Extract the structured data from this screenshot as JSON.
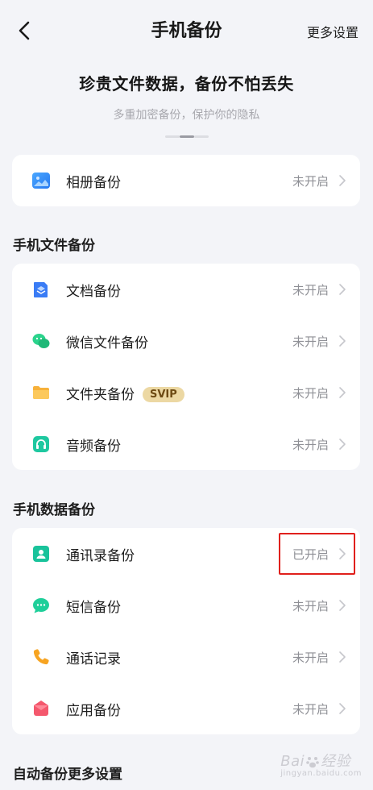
{
  "header": {
    "title": "手机备份",
    "more_settings": "更多设置"
  },
  "hero": {
    "title": "珍贵文件数据，备份不怕丢失",
    "subtitle": "多重加密备份，保护你的隐私"
  },
  "album": {
    "label": "相册备份",
    "status": "未开启",
    "icon": "image-icon",
    "color": "#2f8cf6"
  },
  "file_section": {
    "title": "手机文件备份",
    "items": [
      {
        "label": "文档备份",
        "status": "未开启",
        "icon": "document-icon",
        "color": "#3a7cf5"
      },
      {
        "label": "微信文件备份",
        "status": "未开启",
        "icon": "wechat-icon",
        "color": "#2bd38c"
      },
      {
        "label": "文件夹备份",
        "status": "未开启",
        "icon": "folder-icon",
        "color": "#f7b13a",
        "badge": "SVIP"
      },
      {
        "label": "音频备份",
        "status": "未开启",
        "icon": "headphone-icon",
        "color": "#1ec8a0"
      }
    ]
  },
  "data_section": {
    "title": "手机数据备份",
    "items": [
      {
        "label": "通讯录备份",
        "status": "已开启",
        "icon": "contact-icon",
        "color": "#19c39b"
      },
      {
        "label": "短信备份",
        "status": "未开启",
        "icon": "message-icon",
        "color": "#1fcf9a"
      },
      {
        "label": "通话记录",
        "status": "未开启",
        "icon": "phone-icon",
        "color": "#f7a421"
      },
      {
        "label": "应用备份",
        "status": "未开启",
        "icon": "app-icon",
        "color": "#f4586d"
      }
    ]
  },
  "auto_section": {
    "title": "自动备份更多设置"
  },
  "watermark": {
    "text": "Bai",
    "text2": "经验",
    "sub": "jingyan.baidu.com"
  },
  "colors": {
    "background": "#f3f4f8",
    "highlight": "#e0201c",
    "status_text": "#8f9096",
    "badge_bg": "#ecd8a3"
  }
}
